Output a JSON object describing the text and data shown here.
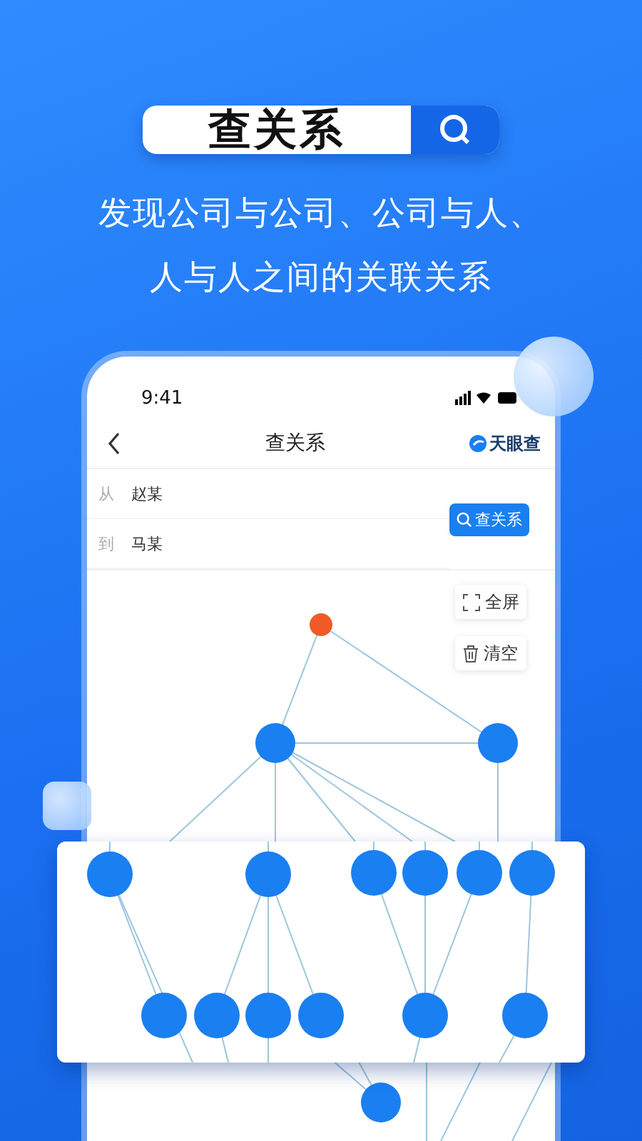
{
  "banner": {
    "search_label": "查关系"
  },
  "headline": [
    "发现公司与公司、公司与人、",
    "人与人之间的关联关系"
  ],
  "phone": {
    "status_time": "9:41",
    "nav_title": "查关系",
    "brand": "天眼查",
    "fields": [
      {
        "label": "从",
        "value": "赵某"
      },
      {
        "label": "到",
        "value": "马某"
      }
    ],
    "query_button": "查关系",
    "tools": [
      {
        "kind": "fullscreen",
        "label": "全屏"
      },
      {
        "kind": "clear",
        "label": "清空"
      }
    ]
  }
}
